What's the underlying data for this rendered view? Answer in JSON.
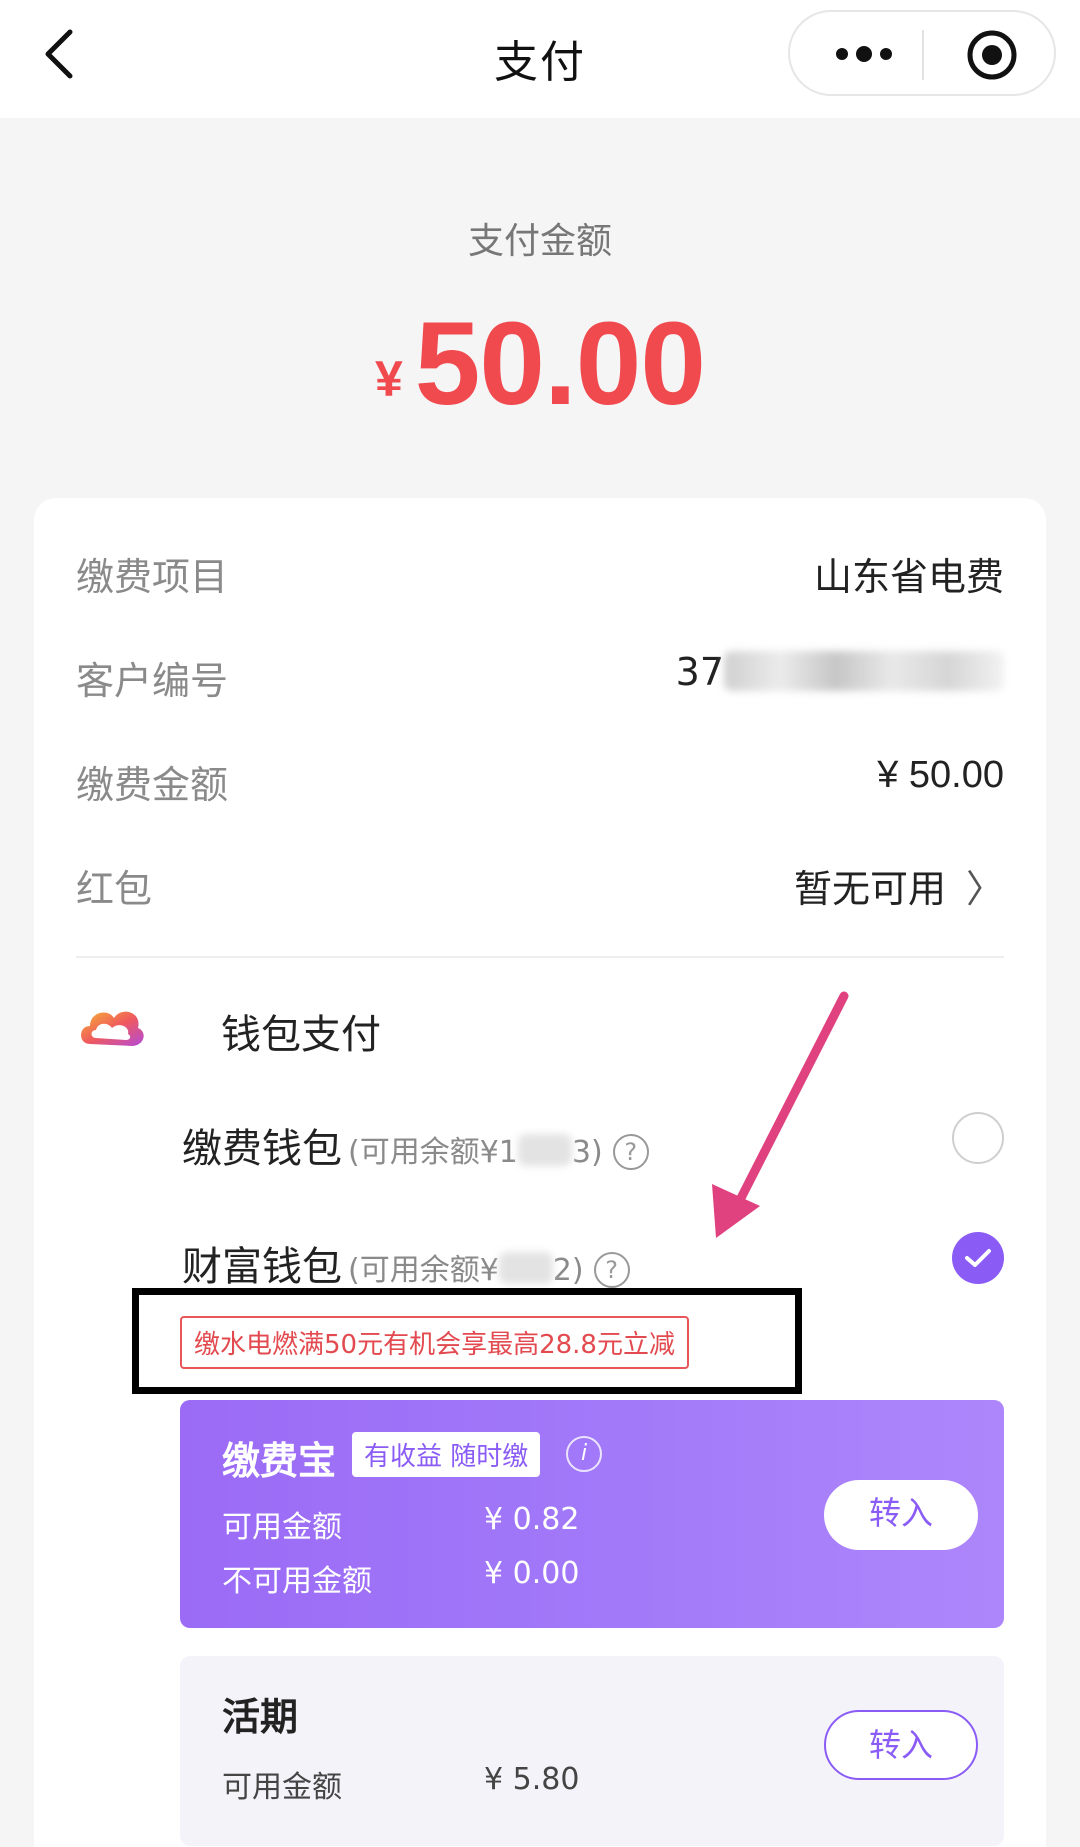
{
  "nav": {
    "title": "支付",
    "back_icon": "back-arrow-icon",
    "more_icon": "more-dots-icon",
    "close_icon": "target-icon"
  },
  "payment": {
    "label": "支付金额",
    "currency": "¥",
    "amount": "50.00"
  },
  "details": [
    {
      "key": "缴费项目",
      "value": "山东省电费"
    },
    {
      "key": "客户编号",
      "value": "37"
    },
    {
      "key": "缴费金额",
      "value": "¥ 50.00"
    },
    {
      "key": "红包",
      "value": "暂无可用"
    }
  ],
  "wallet": {
    "title": "钱包支付",
    "options": [
      {
        "name": "缴费钱包",
        "note_prefix": "(可用余额¥1",
        "note_suffix": "3)",
        "selected": false
      },
      {
        "name": "财富钱包",
        "note_prefix": "(可用余额¥",
        "note_suffix": "2)",
        "selected": true
      }
    ],
    "promo": "缴水电燃满50元有机会享最高28.8元立减"
  },
  "products": [
    {
      "title": "缴费宝",
      "tag": "有收益 随时缴",
      "lines": [
        {
          "label": "可用金额",
          "value": "¥ 0.82"
        },
        {
          "label": "不可用金额",
          "value": "¥ 0.00"
        }
      ],
      "button": "转入"
    },
    {
      "title": "活期",
      "lines": [
        {
          "label": "可用金额",
          "value": "¥ 5.80"
        }
      ],
      "button": "转入"
    }
  ],
  "colors": {
    "amount": "#f04a4f",
    "accent": "#8a5cf5",
    "annotation_arrow": "#e0417f"
  }
}
